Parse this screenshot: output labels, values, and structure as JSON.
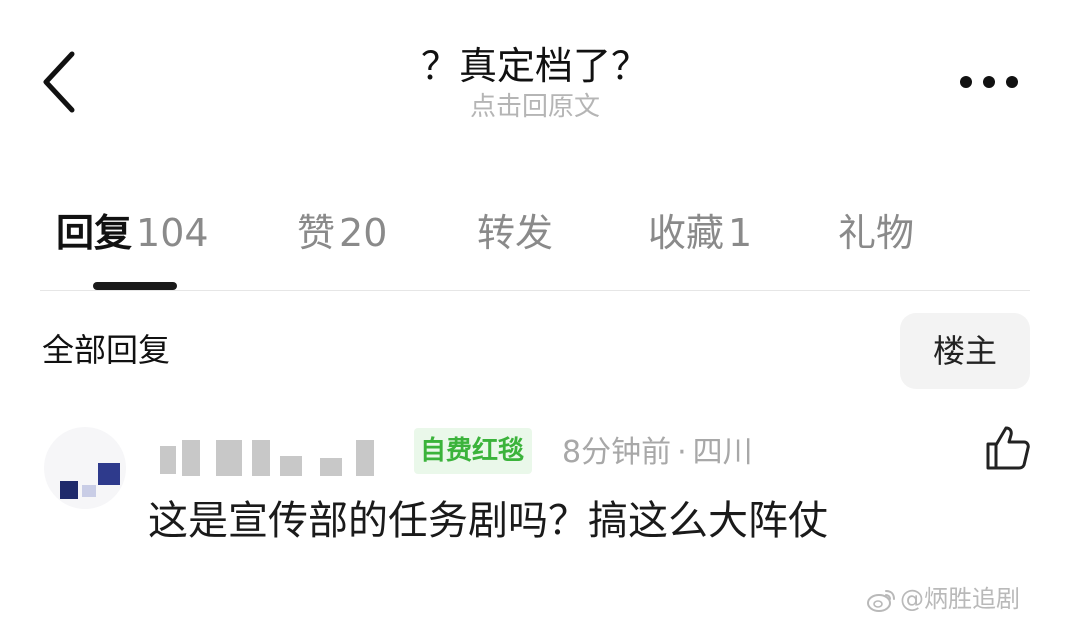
{
  "header": {
    "title": "？真定档了？",
    "subtitle": "点击回原文",
    "back_icon": "chevron-left-icon",
    "more_icon": "more-horizontal-icon"
  },
  "tabs": [
    {
      "label": "回复",
      "count": "104",
      "active": true
    },
    {
      "label": "赞",
      "count": "20",
      "active": false
    },
    {
      "label": "转发",
      "count": "",
      "active": false
    },
    {
      "label": "收藏",
      "count": "1",
      "active": false
    },
    {
      "label": "礼物",
      "count": "",
      "active": false
    }
  ],
  "filter": {
    "all_replies_label": "全部回复",
    "owner_button_label": "楼主"
  },
  "comment": {
    "badge": "自费红毯",
    "time": "8分钟前",
    "separator": "·",
    "location": "四川",
    "text": "这是宣传部的任务剧吗？搞这么大阵仗",
    "like_icon": "thumbs-up-icon",
    "badge_color": "#3bb33b"
  },
  "watermark": {
    "text": "@炳胜追剧",
    "icon": "weibo-logo-icon"
  }
}
